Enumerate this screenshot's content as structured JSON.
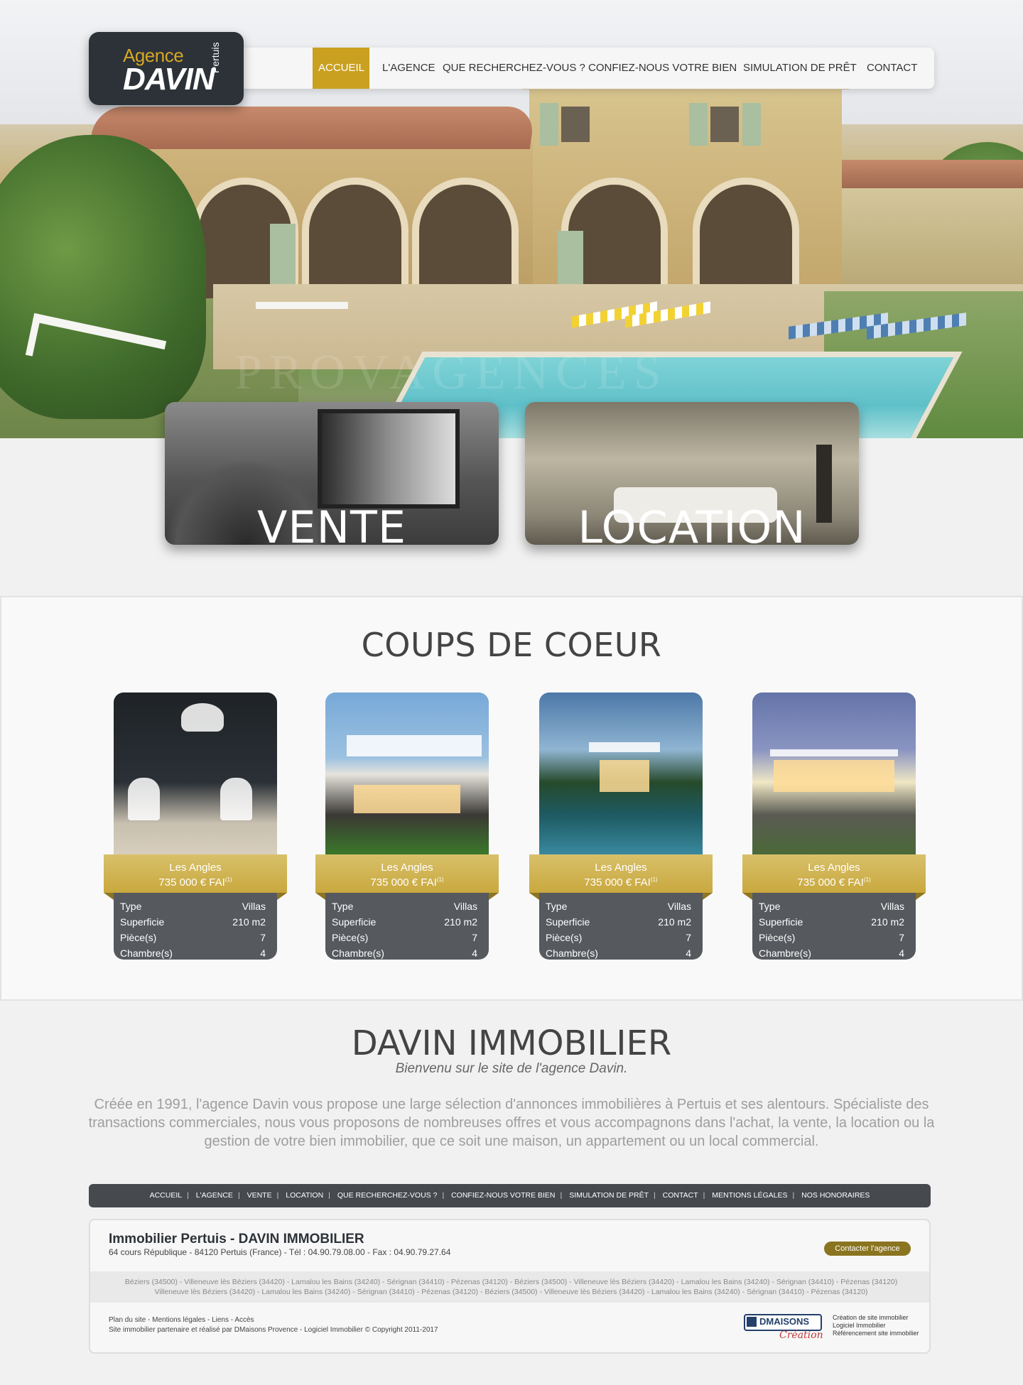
{
  "brand": {
    "logo_line1": "Agence",
    "logo_line2": "DAVIN",
    "logo_line3": "Pertuis",
    "accent_color": "#c9a020",
    "dark_color": "#2d3238"
  },
  "nav": {
    "items": [
      {
        "label": "ACCUEIL",
        "active": true
      },
      {
        "label": "L'AGENCE"
      },
      {
        "label": "QUE RECHERCHEZ-VOUS ?"
      },
      {
        "label": "CONFIEZ-NOUS VOTRE BIEN"
      },
      {
        "label": "SIMULATION DE PRÊT"
      },
      {
        "label": "CONTACT"
      }
    ]
  },
  "hero": {
    "watermark": "PROVAGENCES"
  },
  "categories": {
    "vente": "VENTE",
    "location": "LOCATION"
  },
  "favorites": {
    "title": "COUPS DE COEUR",
    "items": [
      {
        "city": "Les Angles",
        "price": "735 000 € FAI",
        "note": "(1)",
        "type_label": "Type",
        "type": "Villas",
        "surface_label": "Superficie",
        "surface": "210 m2",
        "rooms_label": "Pièce(s)",
        "rooms": "7",
        "bedrooms_label": "Chambre(s)",
        "bedrooms": "4"
      },
      {
        "city": "Les Angles",
        "price": "735 000 € FAI",
        "note": "(1)",
        "type_label": "Type",
        "type": "Villas",
        "surface_label": "Superficie",
        "surface": "210 m2",
        "rooms_label": "Pièce(s)",
        "rooms": "7",
        "bedrooms_label": "Chambre(s)",
        "bedrooms": "4"
      },
      {
        "city": "Les Angles",
        "price": "735 000 € FAI",
        "note": "(1)",
        "type_label": "Type",
        "type": "Villas",
        "surface_label": "Superficie",
        "surface": "210 m2",
        "rooms_label": "Pièce(s)",
        "rooms": "7",
        "bedrooms_label": "Chambre(s)",
        "bedrooms": "4"
      },
      {
        "city": "Les Angles",
        "price": "735 000 € FAI",
        "note": "(1)",
        "type_label": "Type",
        "type": "Villas",
        "surface_label": "Superficie",
        "surface": "210 m2",
        "rooms_label": "Pièce(s)",
        "rooms": "7",
        "bedrooms_label": "Chambre(s)",
        "bedrooms": "4"
      }
    ]
  },
  "about": {
    "title": "DAVIN IMMOBILIER",
    "subtitle": "Bienvenu sur le site de l'agence Davin.",
    "text": "Créée en 1991, l'agence Davin vous propose une large sélection d'annonces immobilières à Pertuis et ses alentours. Spécialiste des transactions commerciales, nous vous proposons de nombreuses offres et vous accompagnons dans l'achat, la vente, la location ou la gestion de votre bien immobilier, que ce soit une maison, un appartement ou un local commercial."
  },
  "footer": {
    "nav": [
      "ACCUEIL",
      "L'AGENCE",
      "VENTE",
      "LOCATION",
      "QUE RECHERCHEZ-VOUS ?",
      "CONFIEZ-NOUS VOTRE BIEN",
      "SIMULATION DE PRÊT",
      "CONTACT",
      "MENTIONS LÉGALES",
      "NOS HONORAIRES"
    ],
    "company": "Immobilier Pertuis - DAVIN IMMOBILIER",
    "address": "64 cours République - 84120 Pertuis (France) - Tél : 04.90.79.08.00 - Fax : 04.90.79.27.64",
    "contact_button": "Contacter l'agence",
    "cities_line1": "Béziers (34500) - Villeneuve lès Béziers (34420) - Lamalou les Bains (34240) - Sérignan (34410) - Pézenas (34120) - Béziers (34500) - Villeneuve lès Béziers (34420) - Lamalou les Bains (34240) - Sérignan (34410) - Pézenas (34120)",
    "cities_line2": "Villeneuve lès Béziers (34420) - Lamalou les Bains (34240) - Sérignan (34410) - Pézenas (34120) - Béziers (34500) - Villeneuve lès Béziers (34420) - Lamalou les Bains (34240) - Sérignan (34410) - Pézenas (34120)",
    "links": "Plan du site - Mentions légales - Liens - Accès",
    "credit": "Site immobilier partenaire et réalisé par DMaisons Provence - Logiciel Immobilier © Copyright 2011-2017",
    "dm_logo_top": "DMAISONS",
    "dm_logo_bottom": "Création",
    "dm_line1": "Création de site immobilier",
    "dm_line2": "Logiciel Immobilier",
    "dm_line3": "Référencement site immobilier"
  }
}
